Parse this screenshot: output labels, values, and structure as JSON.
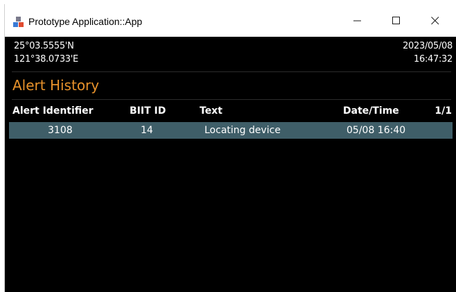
{
  "window": {
    "title": "Prototype Application::App",
    "icon": "app-grid-icon"
  },
  "controls": {
    "minimize_icon": "minimize-icon",
    "maximize_icon": "maximize-icon",
    "close_icon": "close-icon"
  },
  "position": {
    "latitude": "25°03.5555'N",
    "longitude": "121°38.0733'E",
    "date": "2023/05/08",
    "time": "16:47:32"
  },
  "page": {
    "title": "Alert History",
    "title_color": "#e8922b",
    "page_indicator": "1/1"
  },
  "table": {
    "columns": [
      "Alert Identifier",
      "BIIT ID",
      "Text",
      "Date/Time"
    ],
    "rows": [
      {
        "alert_identifier": "3108",
        "biit_id": "14",
        "text": "Locating device",
        "date_time": "05/08 16:40",
        "highlight_color": "#3f5e68"
      }
    ]
  }
}
